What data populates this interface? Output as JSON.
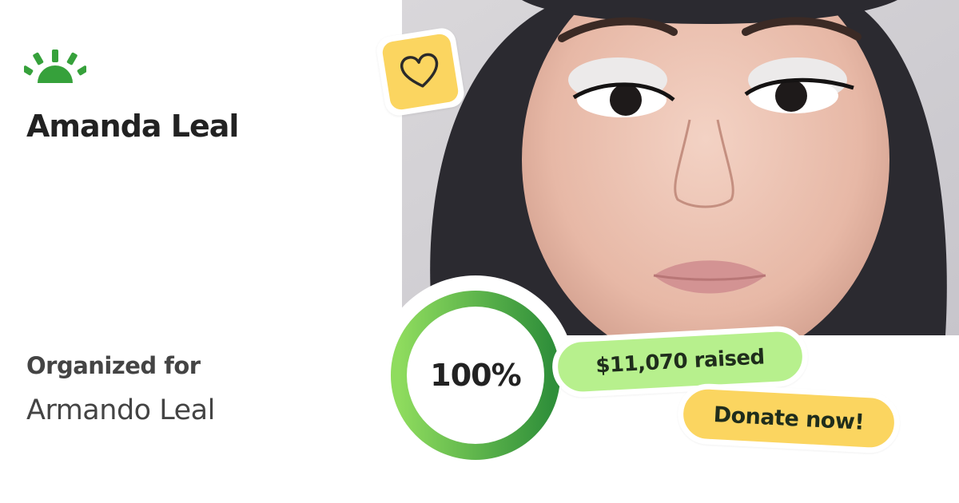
{
  "brand": {
    "logo_icon": "gofundme-sunrise-icon",
    "logo_color": "#36a13b"
  },
  "organizer": {
    "name": "Amanda Leal"
  },
  "beneficiary": {
    "label": "Organized for",
    "name": "Armando Leal"
  },
  "campaign": {
    "progress_text": "100%",
    "progress_fraction": 1.0,
    "raised_text": "$11,070 raised",
    "donate_label": "Donate now!"
  },
  "sticker": {
    "icon": "heart-icon",
    "color": "#fbd560"
  },
  "colors": {
    "ring_green_light": "#8fdc5e",
    "ring_green_dark": "#2f8f3a",
    "raised_pill": "#b7f08d",
    "donate_pill": "#fbd560",
    "text_dark": "#222222",
    "text_muted": "#444444"
  }
}
